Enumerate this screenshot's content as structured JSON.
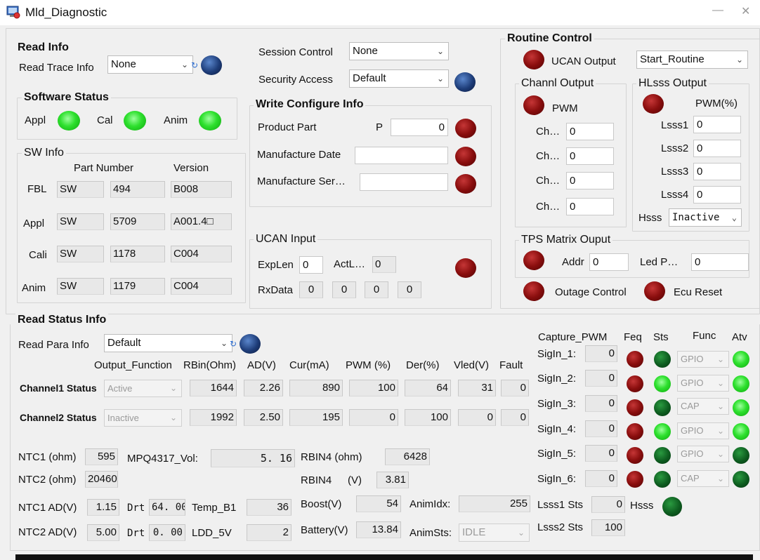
{
  "window": {
    "title": "Mld_Diagnostic"
  },
  "read_info": {
    "title": "Read Info",
    "trace_label": "Read Trace Info",
    "trace_value": "None"
  },
  "software_status": {
    "title": "Software Status",
    "appl": "Appl",
    "cal": "Cal",
    "anim": "Anim"
  },
  "sw_info": {
    "title": "SW Info",
    "col_part": "Part Number",
    "col_version": "Version",
    "rows": [
      {
        "label": "FBL",
        "sw": "SW",
        "part": "494",
        "version": "B008"
      },
      {
        "label": "Appl",
        "sw": "SW",
        "part": "5709",
        "version": "A001.4□"
      },
      {
        "label": "Cali",
        "sw": "SW",
        "part": "1178",
        "version": "C004"
      },
      {
        "label": "Anim",
        "sw": "SW",
        "part": "1179",
        "version": "C004"
      }
    ]
  },
  "session": {
    "label": "Session Control",
    "value": "None",
    "security_label": "Security Access",
    "security_value": "Default"
  },
  "write_config": {
    "title": "Write Configure Info",
    "product_part": "Product Part",
    "p": "P",
    "p_value": "0",
    "manufacture_date": "Manufacture Date",
    "manufacture_ser": "Manufacture Ser…"
  },
  "ucan_input": {
    "title": "UCAN Input",
    "explen": "ExpLen",
    "explen_value": "0",
    "actl": "ActL…",
    "actl_value": "0",
    "rxdata": "RxData",
    "rx": [
      "0",
      "0",
      "0",
      "0"
    ]
  },
  "routine": {
    "title": "Routine Control",
    "ucan_output": "UCAN Output",
    "routine_value": "Start_Routine",
    "channl_output": "Channl Output",
    "pwm": "PWM",
    "ch_labels": [
      "Ch…",
      "Ch…",
      "Ch…",
      "Ch…"
    ],
    "ch_values": [
      "0",
      "0",
      "0",
      "0"
    ],
    "hlsss_output": "HLsss Output",
    "pwm_pct": "PWM(%)",
    "lsss": [
      {
        "label": "Lsss1",
        "value": "0"
      },
      {
        "label": "Lsss2",
        "value": "0"
      },
      {
        "label": "Lsss3",
        "value": "0"
      },
      {
        "label": "Lsss4",
        "value": "0"
      }
    ],
    "hsss": "Hsss",
    "hsss_value": "Inactive",
    "tps_title": "TPS Matrix Ouput",
    "addr": "Addr",
    "addr_value": "0",
    "ledp": "Led P…",
    "ledp_value": "0",
    "outage": "Outage Control",
    "ecu_reset": "Ecu Reset"
  },
  "read_status": {
    "title": "Read Status Info",
    "para_label": "Read Para Info",
    "para_value": "Default",
    "headers": [
      "Output_Function",
      "RBin(Ohm)",
      "AD(V)",
      "Cur(mA)",
      "PWM (%)",
      "Der(%)",
      "Vled(V)",
      "Fault"
    ],
    "channels": [
      {
        "label": "Channel1 Status",
        "func": "Active",
        "rbin": "1644",
        "ad": "2.26",
        "cur": "890",
        "pwm": "100",
        "der": "64",
        "vled": "31",
        "fault": "0"
      },
      {
        "label": "Channel2 Status",
        "func": "Inactive",
        "rbin": "1992",
        "ad": "2.50",
        "cur": "195",
        "pwm": "0",
        "der": "100",
        "vled": "0",
        "fault": "0"
      }
    ],
    "ntc1_ohm": "NTC1 (ohm)",
    "ntc1_ohm_value": "595",
    "mpq_label": "MPQ4317_Vol:",
    "mpq_value": "5. 16",
    "rbin4_ohm": "RBIN4 (ohm)",
    "rbin4_ohm_value": "6428",
    "ntc2_ohm": "NTC2 (ohm)",
    "ntc2_ohm_value": "20460",
    "rbin4_v_label": "RBIN4",
    "rbin4_v_unit": "(V)",
    "rbin4_v_value": "3.81",
    "ntc1_ad": "NTC1 AD(V)",
    "ntc1_ad_value": "1.15",
    "drt": "Drt",
    "drt1_value": "64. 00",
    "temp_b1": "Temp_B1",
    "temp_b1_value": "36",
    "boost": "Boost(V)",
    "boost_value": "54",
    "animidx": "AnimIdx:",
    "animidx_value": "255",
    "ntc2_ad": "NTC2 AD(V)",
    "ntc2_ad_value": "5.00",
    "drt2_value": "0. 00",
    "ldd": "LDD_5V",
    "ldd_value": "2",
    "battery": "Battery(V)",
    "battery_value": "13.84",
    "animsts": "AnimSts:",
    "animsts_value": "IDLE"
  },
  "capture": {
    "title": "Capture_PWM",
    "feq": "Feq",
    "sts": "Sts",
    "func": "Func",
    "atv": "Atv",
    "rows": [
      {
        "label": "SigIn_1:",
        "value": "0",
        "sts": "dark",
        "func": "GPIO",
        "atv": "bright"
      },
      {
        "label": "SigIn_2:",
        "value": "0",
        "sts": "bright",
        "func": "GPIO",
        "atv": "bright"
      },
      {
        "label": "SigIn_3:",
        "value": "0",
        "sts": "dark",
        "func": "CAP",
        "atv": "bright"
      },
      {
        "label": "SigIn_4:",
        "value": "0",
        "sts": "bright",
        "func": "GPIO",
        "atv": "bright"
      },
      {
        "label": "SigIn_5:",
        "value": "0",
        "sts": "dark",
        "func": "GPIO",
        "atv": "dark"
      },
      {
        "label": "SigIn_6:",
        "value": "0",
        "sts": "dark",
        "func": "CAP",
        "atv": "dark"
      }
    ],
    "lsss1": "Lsss1 Sts",
    "lsss1_value": "0",
    "hsss": "Hsss",
    "lsss2": "Lsss2 Sts",
    "lsss2_value": "100"
  },
  "colors": {
    "led_red": "#8a0e0e",
    "led_green": "#2ee02e",
    "led_dark_green": "#0d5c1f",
    "led_blue": "#1d3c78"
  }
}
